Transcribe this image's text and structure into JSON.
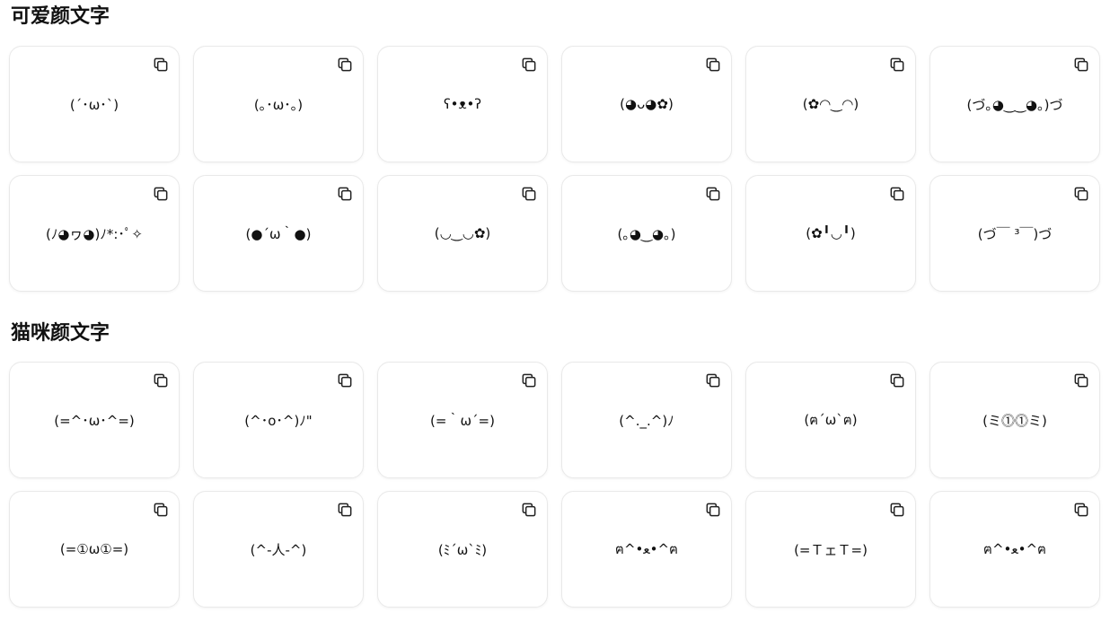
{
  "sections": [
    {
      "title": "可爱颜文字",
      "items": [
        "(´･ω･`)",
        "(｡･ω･｡)",
        "ʕ•ᴥ•ʔ",
        "(◕ᴗ◕✿)",
        "(✿◠‿◠)",
        "(づ｡◕‿‿◕｡)づ",
        "(ﾉ◕ヮ◕)ﾉ*:･ﾟ✧",
        "(●´ω｀●)",
        "(◡‿◡✿)",
        "(｡◕‿◕｡)",
        "(✿╹◡╹)",
        "(づ￣ ³￣)づ"
      ]
    },
    {
      "title": "猫咪颜文字",
      "items": [
        "(=^･ω･^=)",
        "(^･o･^)ﾉ\"",
        "(=｀ω´=)",
        "(^._.^)ﾉ",
        "(ฅ´ω`ฅ)",
        "(ミ⓵⓵ミ)",
        "(=①ω①=)",
        "(^-人-^)",
        "(ﾐ´ω`ﾐ)",
        "ฅ^•ﻌ•^ฅ",
        "(=ＴェＴ=)",
        "ฅ^•ﻌ•^ฅ"
      ]
    }
  ],
  "icons": {
    "copy": "copy-icon"
  }
}
